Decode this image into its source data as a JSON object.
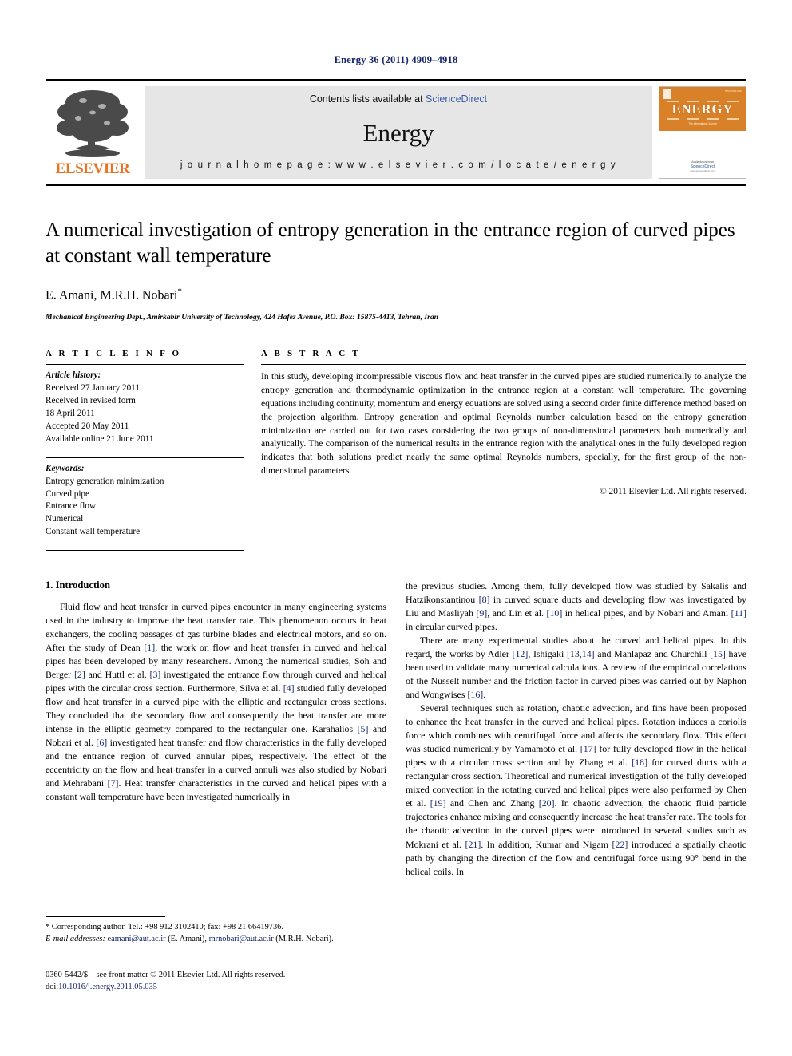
{
  "running_head": "Energy 36 (2011) 4909–4918",
  "banner": {
    "publisher_name": "ELSEVIER",
    "contents_prefix": "Contents lists available at ",
    "contents_link": "ScienceDirect",
    "journal_name": "Energy",
    "homepage": "j o u r n a l   h o m e p a g e :   w w w . e l s e v i e r . c o m / l o c a t e / e n e r g y",
    "cover": {
      "title": "ENERGY",
      "subtitle": "The International Journal",
      "available_at": "Available online at",
      "sciencedirect": "ScienceDirect",
      "url": "www.sciencedirect.com",
      "issue_code": "ISSN 0360-5442"
    }
  },
  "article": {
    "title": "A numerical investigation of entropy generation in the entrance region of curved pipes at constant wall temperature",
    "authors": "E. Amani, M.R.H. Nobari",
    "corresponding_marker": "*",
    "affiliation": "Mechanical Engineering Dept., Amirkabir University of Technology, 424 Hafez Avenue, P.O. Box: 15875-4413, Tehran, Iran"
  },
  "article_info": {
    "heading": "A R T I C L E   I N F O",
    "history_label": "Article history:",
    "history": [
      "Received 27 January 2011",
      "Received in revised form",
      "18 April 2011",
      "Accepted 20 May 2011",
      "Available online 21 June 2011"
    ],
    "keywords_label": "Keywords:",
    "keywords": [
      "Entropy generation minimization",
      "Curved pipe",
      "Entrance flow",
      "Numerical",
      "Constant wall temperature"
    ]
  },
  "abstract": {
    "heading": "A B S T R A C T",
    "text": "In this study, developing incompressible viscous flow and heat transfer in the curved pipes are studied numerically to analyze the entropy generation and thermodynamic optimization in the entrance region at a constant wall temperature. The governing equations including continuity, momentum and energy equations are solved using a second order finite difference method based on the projection algorithm. Entropy generation and optimal Reynolds number calculation based on the entropy generation minimization are carried out for two cases considering the two groups of non-dimensional parameters both numerically and analytically. The comparison of the numerical results in the entrance region with the analytical ones in the fully developed region indicates that both solutions predict nearly the same optimal Reynolds numbers, specially, for the first group of the non-dimensional parameters.",
    "copyright": "© 2011 Elsevier Ltd. All rights reserved."
  },
  "body": {
    "section_number_title": "1.  Introduction",
    "left_paragraphs": [
      "Fluid flow and heat transfer in curved pipes encounter in many engineering systems used in the industry to improve the heat transfer rate. This phenomenon occurs in heat exchangers, the cooling passages of gas turbine blades and electrical motors, and so on. After the study of Dean [1], the work on flow and heat transfer in curved and helical pipes has been developed by many researchers. Among the numerical studies, Soh and Berger [2] and Huttl et al. [3] investigated the entrance flow through curved and helical pipes with the circular cross section. Furthermore, Silva et al. [4] studied fully developed flow and heat transfer in a curved pipe with the elliptic and rectangular cross sections. They concluded that the secondary flow and consequently the heat transfer are more intense in the elliptic geometry compared to the rectangular one. Karahalios [5] and Nobari et al. [6] investigated heat transfer and flow characteristics in the fully developed and the entrance region of curved annular pipes, respectively. The effect of the eccentricity on the flow and heat transfer in a curved annuli was also studied by Nobari and Mehrabani [7]. Heat transfer characteristics in the curved and helical pipes with a constant wall temperature have been investigated numerically in"
    ],
    "right_paragraphs": [
      "the previous studies. Among them, fully developed flow was studied by Sakalis and Hatzikonstantinou [8] in curved square ducts and developing flow was investigated by Liu and Masliyah [9], and Lin et al. [10] in helical pipes, and by Nobari and Amani [11] in circular curved pipes.",
      "There are many experimental studies about the curved and helical pipes. In this regard, the works by Adler [12], Ishigaki [13,14] and Manlapaz and Churchill [15] have been used to validate many numerical calculations. A review of the empirical correlations of the Nusselt number and the friction factor in curved pipes was carried out by Naphon and Wongwises [16].",
      "Several techniques such as rotation, chaotic advection, and fins have been proposed to enhance the heat transfer in the curved and helical pipes. Rotation induces a coriolis force which combines with centrifugal force and affects the secondary flow. This effect was studied numerically by Yamamoto et al. [17] for fully developed flow in the helical pipes with a circular cross section and by Zhang et al. [18] for curved ducts with a rectangular cross section. Theoretical and numerical investigation of the fully developed mixed convection in the rotating curved and helical pipes were also performed by Chen et al. [19] and Chen and Zhang [20]. In chaotic advection, the chaotic fluid particle trajectories enhance mixing and consequently increase the heat transfer rate. The tools for the chaotic advection in the curved pipes were introduced in several studies such as Mokrani et al. [21]. In addition, Kumar and Nigam [22] introduced a spatially chaotic path by changing the direction of the flow and centrifugal force using 90° bend in the helical coils. In"
    ]
  },
  "footnote": {
    "corresponding": "* Corresponding author. Tel.: +98 912 3102410; fax: +98 21 66419736.",
    "email_label": "E-mail addresses:",
    "email1": "eamani@aut.ac.ir",
    "email1_owner": "(E. Amani)",
    "email2": "mrnobari@aut.ac.ir",
    "email2_owner": "(M.R.H. Nobari)."
  },
  "imprint": {
    "line1": "0360-5442/$ – see front matter © 2011 Elsevier Ltd. All rights reserved.",
    "doi_label": "doi:",
    "doi": "10.1016/j.energy.2011.05.035"
  },
  "colors": {
    "link_blue": "#16256b",
    "sciencedirect_blue": "#3b5ea8",
    "elsevier_orange": "#e87424",
    "cover_orange": "#d98128"
  }
}
